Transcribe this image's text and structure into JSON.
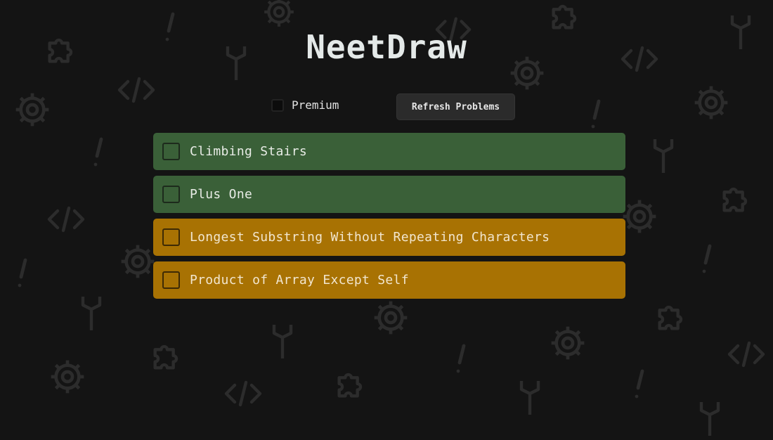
{
  "app": {
    "title": "NeetDraw"
  },
  "controls": {
    "premium_label": "Premium",
    "premium_checked": false,
    "refresh_label": "Refresh Problems"
  },
  "problems": [
    {
      "name": "Climbing Stairs",
      "difficulty": "easy",
      "color": "#3a6038",
      "checked": false
    },
    {
      "name": "Plus One",
      "difficulty": "easy",
      "color": "#3a6038",
      "checked": false
    },
    {
      "name": "Longest Substring Without Repeating Characters",
      "difficulty": "medium",
      "color": "#a87203",
      "checked": false
    },
    {
      "name": "Product of Array Except Self",
      "difficulty": "medium",
      "color": "#a87203",
      "checked": false
    }
  ],
  "background": {
    "color": "#141414",
    "doodle_color": "#2c2c2c",
    "doodle_icons": [
      "gear-icon",
      "wrench-icon",
      "puzzle-icon",
      "code-icon",
      "exclamation-icon"
    ]
  }
}
